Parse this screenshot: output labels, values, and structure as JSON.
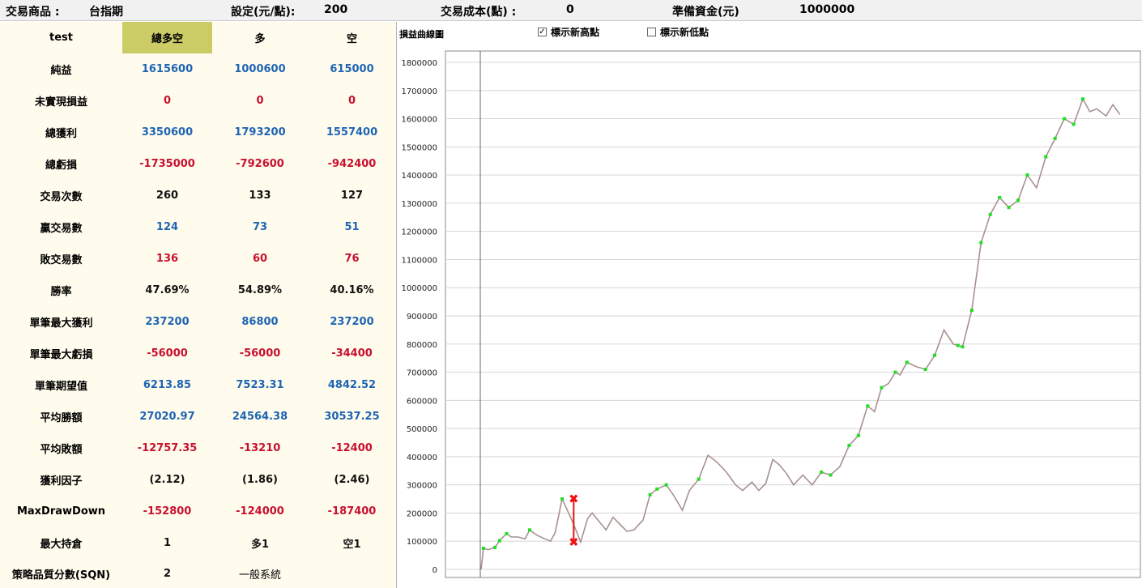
{
  "topbar": {
    "product_label": "交易商品 :",
    "product_value": "台指期",
    "setting_label": "設定(元/點):",
    "setting_value": "200",
    "cost_label": "交易成本(點) :",
    "cost_value": "0",
    "capital_label": "準備資金(元)",
    "capital_value": "1000000"
  },
  "stats": {
    "headers": [
      "test",
      "總多空",
      "多",
      "空"
    ],
    "rows": [
      {
        "label": "純益",
        "values": [
          "1615600",
          "1000600",
          "615000"
        ],
        "color": "blue"
      },
      {
        "label": "未實現損益",
        "values": [
          "0",
          "0",
          "0"
        ],
        "color": "red"
      },
      {
        "label": "總獲利",
        "values": [
          "3350600",
          "1793200",
          "1557400"
        ],
        "color": "blue"
      },
      {
        "label": "總虧損",
        "values": [
          "-1735000",
          "-792600",
          "-942400"
        ],
        "color": "red"
      },
      {
        "label": "交易次數",
        "values": [
          "260",
          "133",
          "127"
        ],
        "color": "black"
      },
      {
        "label": "贏交易數",
        "values": [
          "124",
          "73",
          "51"
        ],
        "color": "blue"
      },
      {
        "label": "敗交易數",
        "values": [
          "136",
          "60",
          "76"
        ],
        "color": "red"
      },
      {
        "label": "勝率",
        "values": [
          "47.69%",
          "54.89%",
          "40.16%"
        ],
        "color": "black"
      },
      {
        "label": "單筆最大獲利",
        "values": [
          "237200",
          "86800",
          "237200"
        ],
        "color": "blue"
      },
      {
        "label": "單筆最大虧損",
        "values": [
          "-56000",
          "-56000",
          "-34400"
        ],
        "color": "red"
      },
      {
        "label": "單筆期望值",
        "values": [
          "6213.85",
          "7523.31",
          "4842.52"
        ],
        "color": "blue"
      },
      {
        "label": "平均勝額",
        "values": [
          "27020.97",
          "24564.38",
          "30537.25"
        ],
        "color": "blue"
      },
      {
        "label": "平均敗額",
        "values": [
          "-12757.35",
          "-13210",
          "-12400"
        ],
        "color": "red"
      },
      {
        "label": "獲利因子",
        "values": [
          "(2.12)",
          "(1.86)",
          "(2.46)"
        ],
        "color": "black"
      },
      {
        "label": "MaxDrawDown",
        "values": [
          "-152800",
          "-124000",
          "-187400"
        ],
        "color": "red"
      },
      {
        "label": "最大持倉",
        "values": [
          "1",
          "多1",
          "空1"
        ],
        "color": "black"
      }
    ],
    "sqn": {
      "label": "策略品質分數(SQN)",
      "value": "2",
      "grade": "一般系統"
    }
  },
  "chart_header": {
    "title": "損益曲線圖",
    "show_new_high": {
      "label": "標示新高點",
      "checked": true
    },
    "show_new_low": {
      "label": "標示新低點",
      "checked": false
    }
  },
  "chart_data": {
    "type": "line",
    "title": "損益曲線圖",
    "xlabel": "",
    "ylabel": "",
    "ylim": [
      0,
      1800000
    ],
    "yticks": [
      "1800000",
      "1700000",
      "1600000",
      "1500000",
      "1400000",
      "1300000",
      "1200000",
      "1100000",
      "1000000",
      "900000",
      "800000",
      "700000",
      "600000",
      "500000",
      "400000",
      "300000",
      "200000",
      "100000",
      "0"
    ],
    "grid": true,
    "colors": {
      "line": "#a89090",
      "new_high": "#22dd22",
      "drawdown": "#ee1111"
    },
    "x": [
      0,
      1,
      3,
      6,
      8,
      11,
      13,
      16,
      19,
      21,
      24,
      27,
      30,
      32,
      35,
      37,
      40,
      43,
      46,
      48,
      51,
      54,
      57,
      60,
      63,
      66,
      70,
      73,
      76,
      80,
      83,
      87,
      90,
      94,
      98,
      102,
      106,
      110,
      113,
      117,
      120,
      123,
      126,
      129,
      132,
      135,
      139,
      143,
      147,
      151,
      155,
      159,
      163,
      167,
      170,
      173,
      176,
      179,
      181,
      184,
      188,
      192,
      196,
      200,
      204,
      208,
      212,
      216,
      220,
      224,
      228,
      232,
      236,
      240,
      244,
      248,
      252,
      256,
      260
    ],
    "values": [
      0,
      75000,
      70000,
      78000,
      102000,
      127000,
      115000,
      115000,
      108000,
      140000,
      122000,
      110000,
      100000,
      130000,
      250000,
      215000,
      160000,
      97000,
      180000,
      200000,
      170000,
      140000,
      185000,
      160000,
      135000,
      140000,
      175000,
      265000,
      285000,
      300000,
      265000,
      210000,
      280000,
      320000,
      405000,
      380000,
      345000,
      300000,
      280000,
      310000,
      280000,
      305000,
      390000,
      370000,
      340000,
      300000,
      335000,
      300000,
      345000,
      335000,
      365000,
      440000,
      475000,
      580000,
      560000,
      645000,
      660000,
      700000,
      690000,
      735000,
      720000,
      710000,
      760000,
      850000,
      800000,
      790000,
      920000,
      1160000,
      1260000,
      1320000,
      1285000,
      1310000,
      1400000,
      1355000,
      1465000,
      1530000,
      1600000,
      1580000,
      1670000
    ],
    "tail_x": [
      263,
      266,
      270,
      273,
      276
    ],
    "tail_values": [
      1625000,
      1635000,
      1610000,
      1650000,
      1615000
    ],
    "new_high_x": [
      1,
      6,
      8,
      11,
      21,
      35,
      73,
      76,
      80,
      94,
      147,
      151,
      159,
      163,
      167,
      173,
      179,
      184,
      192,
      196,
      206,
      208,
      212,
      216,
      220,
      224,
      228,
      232,
      236,
      244,
      248,
      252,
      256,
      260
    ],
    "max_drawdown": {
      "from_value": 250000,
      "to_value": 97000,
      "x": 40
    }
  }
}
